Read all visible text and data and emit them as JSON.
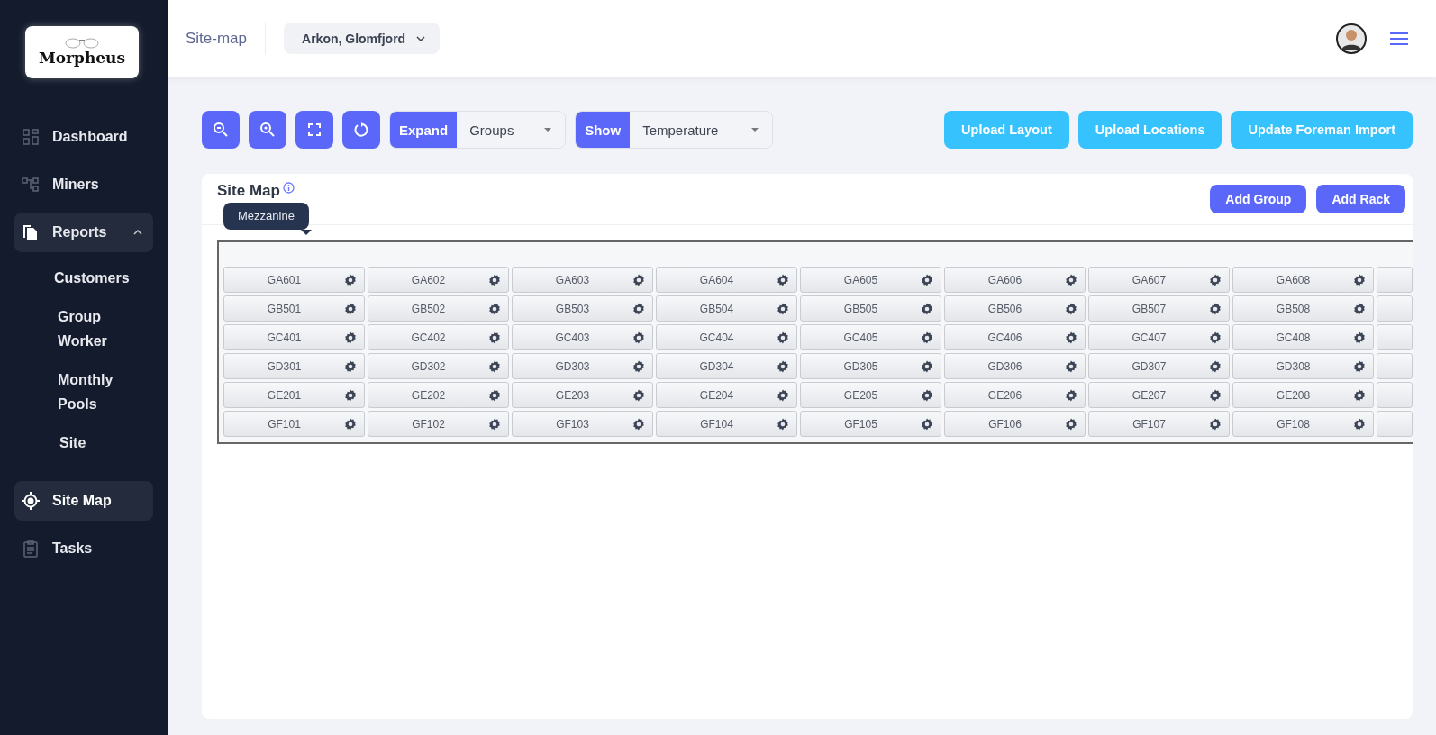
{
  "logo": {
    "text": "Morpheus"
  },
  "sidebar": {
    "items": [
      {
        "label": "Dashboard",
        "selected": false
      },
      {
        "label": "Miners",
        "selected": false
      },
      {
        "label": "Reports",
        "selected": false,
        "expanded": true,
        "children": [
          {
            "label": "Customers"
          },
          {
            "label": "Group Worker"
          },
          {
            "label": "Monthly Pools"
          },
          {
            "label": "Site"
          }
        ]
      },
      {
        "label": "Site Map",
        "selected": true
      },
      {
        "label": "Tasks",
        "selected": false
      }
    ]
  },
  "header": {
    "breadcrumb": "Site-map",
    "site_select": "Arkon, Glomfjord"
  },
  "toolbar": {
    "expand": {
      "label": "Expand",
      "value": "Groups"
    },
    "show": {
      "label": "Show",
      "value": "Temperature"
    },
    "buttons": [
      "Upload Layout",
      "Upload Locations",
      "Update Foreman Import"
    ]
  },
  "card": {
    "title": "Site Map",
    "tooltip": "Mezzanine",
    "buttons": [
      "Add Group",
      "Add Rack"
    ],
    "rows": [
      {
        "cells": [
          "GA601",
          "GA602",
          "GA603",
          "GA604",
          "GA605",
          "GA606",
          "GA607",
          "GA608"
        ]
      },
      {
        "cells": [
          "GB501",
          "GB502",
          "GB503",
          "GB504",
          "GB505",
          "GB506",
          "GB507",
          "GB508"
        ]
      },
      {
        "cells": [
          "GC401",
          "GC402",
          "GC403",
          "GC404",
          "GC405",
          "GC406",
          "GC407",
          "GC408"
        ]
      },
      {
        "cells": [
          "GD301",
          "GD302",
          "GD303",
          "GD304",
          "GD305",
          "GD306",
          "GD307",
          "GD308"
        ]
      },
      {
        "cells": [
          "GE201",
          "GE202",
          "GE203",
          "GE204",
          "GE205",
          "GE206",
          "GE207",
          "GE208"
        ]
      },
      {
        "cells": [
          "GF101",
          "GF102",
          "GF103",
          "GF104",
          "GF105",
          "GF106",
          "GF107",
          "GF108"
        ]
      }
    ]
  }
}
